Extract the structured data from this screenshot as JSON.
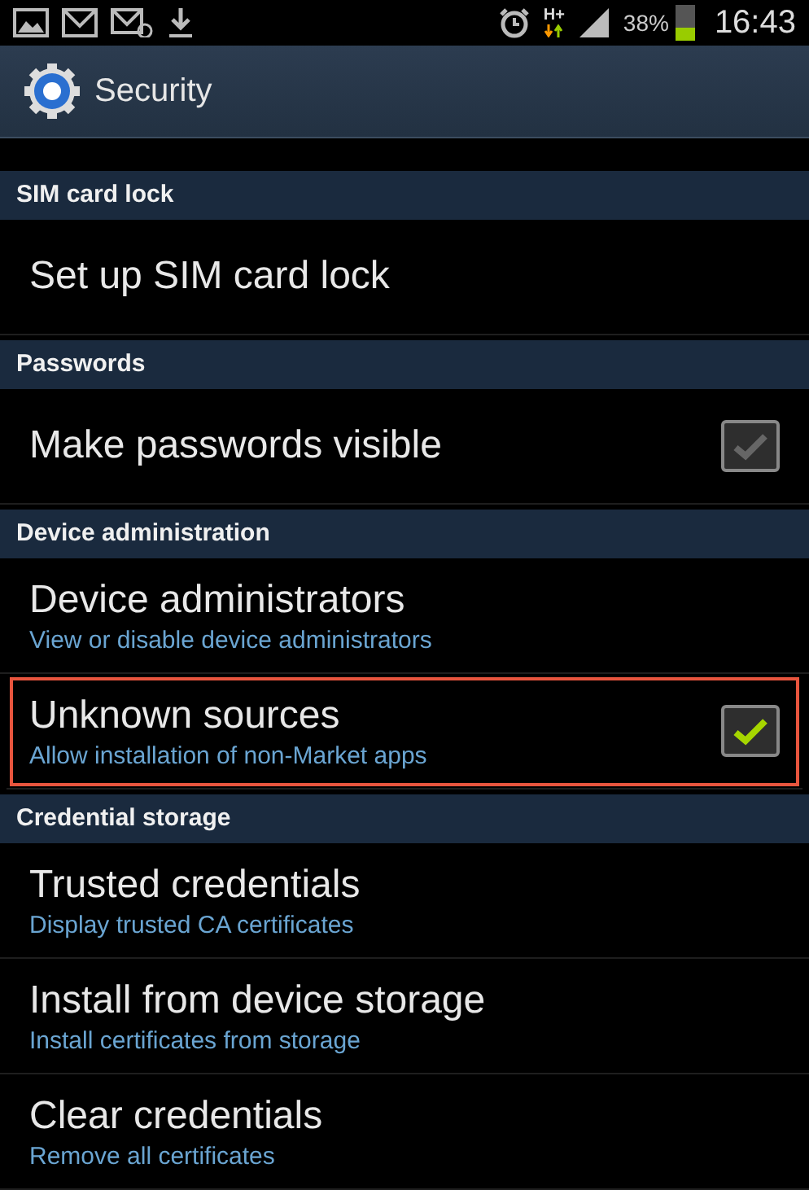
{
  "status_bar": {
    "network": "H+",
    "battery_percent": "38%",
    "time": "16:43"
  },
  "header": {
    "title": "Security"
  },
  "sections": [
    {
      "title": "SIM card lock",
      "items": [
        {
          "kind": "plain",
          "title": "Set up SIM card lock"
        }
      ]
    },
    {
      "title": "Passwords",
      "items": [
        {
          "kind": "checkbox",
          "title": "Make passwords visible",
          "checked": false
        }
      ]
    },
    {
      "title": "Device administration",
      "items": [
        {
          "kind": "plain",
          "title": "Device administrators",
          "summary": "View or disable device administrators"
        },
        {
          "kind": "checkbox",
          "title": "Unknown sources",
          "summary": "Allow installation of non-Market apps",
          "checked": true,
          "highlighted": true
        }
      ]
    },
    {
      "title": "Credential storage",
      "items": [
        {
          "kind": "plain",
          "title": "Trusted credentials",
          "summary": "Display trusted CA certificates"
        },
        {
          "kind": "plain",
          "title": "Install from device storage",
          "summary": "Install certificates from storage"
        },
        {
          "kind": "plain",
          "title": "Clear credentials",
          "summary": "Remove all certificates"
        }
      ]
    }
  ]
}
